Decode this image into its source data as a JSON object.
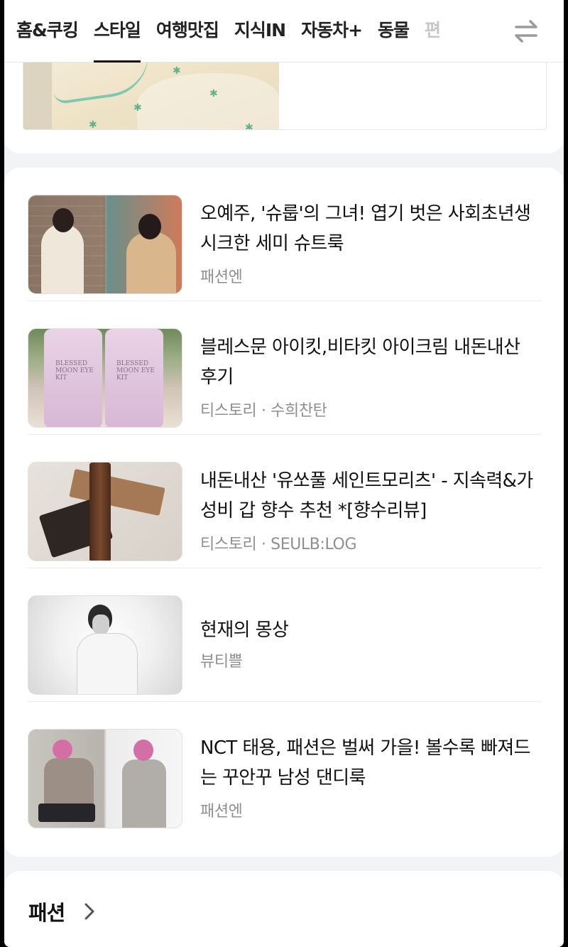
{
  "tabs": [
    {
      "label": "홈&쿠킹"
    },
    {
      "label": "스타일",
      "active": true
    },
    {
      "label": "여행맛집"
    },
    {
      "label": "지식IN"
    },
    {
      "label": "자동차+"
    },
    {
      "label": "동물"
    },
    {
      "label": "편"
    }
  ],
  "tab_menu_icon": "swap-arrows-icon",
  "feed": {
    "items": [
      {
        "title": "오예주, '슈룹'의 그녀! 엽기 벗은 사회초년생 시크한 세미 슈트룩",
        "source": "패션엔"
      },
      {
        "title": "블레스문 아이킷,비타킷 아이크림 내돈내산 후기",
        "source": "티스토리 · 수희찬탄",
        "thumb_text": "BLESSED MOON EYE KIT"
      },
      {
        "title": "내돈내산 '유쏘풀 세인트모리츠' - 지속력&가성비 갑 향수 추천 *[향수리뷰]",
        "source": "티스토리 · SEULB:LOG"
      },
      {
        "title": "현재의 몽상",
        "source": "뷰티쁠"
      },
      {
        "title": "NCT 태용, 패션은 벌써 가을! 볼수록 빠져드는 꾸안꾸 남성 댄디룩",
        "source": "패션엔"
      }
    ]
  },
  "section": {
    "title": "패션"
  },
  "colors": {
    "background": "#f1f3f5",
    "card": "#ffffff",
    "source_text": "#8f8f8f",
    "title_text": "#111111"
  }
}
